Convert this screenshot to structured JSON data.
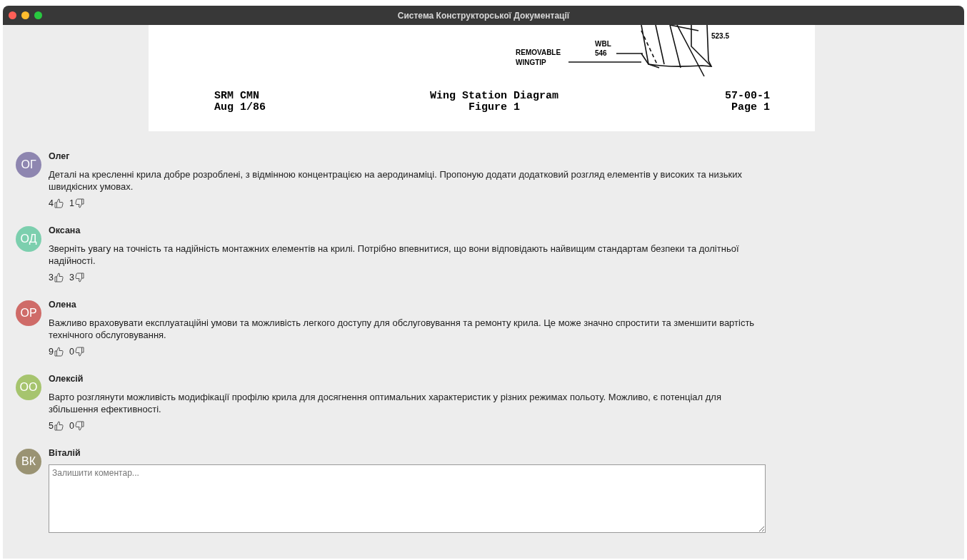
{
  "window": {
    "title": "Система Конструкторської Документації"
  },
  "document": {
    "labels": [
      {
        "kind": "callout",
        "text": "523.5"
      },
      {
        "kind": "callout",
        "text": "WBL"
      },
      {
        "kind": "callout",
        "text": "546"
      },
      {
        "kind": "callout",
        "text": "REMOVABLE"
      },
      {
        "kind": "callout",
        "text": "WINGTIP"
      }
    ],
    "footer_left": [
      "SRM CMN",
      "Aug 1/86"
    ],
    "footer_center": [
      "Wing Station Diagram",
      "Figure 1"
    ],
    "footer_right": [
      "57-00-1",
      "Page 1"
    ]
  },
  "comments": [
    {
      "initials": "ОГ",
      "color": "#8e86b0",
      "author": "Олег",
      "text": "Деталі на кресленні крила добре розроблені, з відмінною концентрацією на аеродинаміці. Пропоную додати додатковий розгляд елементів у високих та низьких швидкісних умовах.",
      "likes": "4",
      "dislikes": "1"
    },
    {
      "initials": "ОД",
      "color": "#7ccfae",
      "author": "Оксана",
      "text": "Зверніть увагу на точність та надійність монтажних елементів на крилі. Потрібно впевнитися, що вони відповідають найвищим стандартам безпеки та долітньої надійності.",
      "likes": "3",
      "dislikes": "3"
    },
    {
      "initials": "ОР",
      "color": "#cf6b68",
      "author": "Олена",
      "text": "Важливо враховувати експлуатаційні умови та можливість легкого доступу для обслуговування та ремонту крила. Це може значно спростити та зменшити вартість технічного обслуговування.",
      "likes": "9",
      "dislikes": "0"
    },
    {
      "initials": "ОО",
      "color": "#a6c46e",
      "author": "Олексій",
      "text": "Варто розглянути можливість модифікації профілю крила для досягнення оптимальних характеристик у різних режимах польоту. Можливо, є потенціал для збільшення ефективності.",
      "likes": "5",
      "dislikes": "0"
    }
  ],
  "new_comment": {
    "initials": "ВК",
    "color": "#9a9373",
    "author": "Віталій",
    "placeholder": "Залишити коментар..."
  }
}
